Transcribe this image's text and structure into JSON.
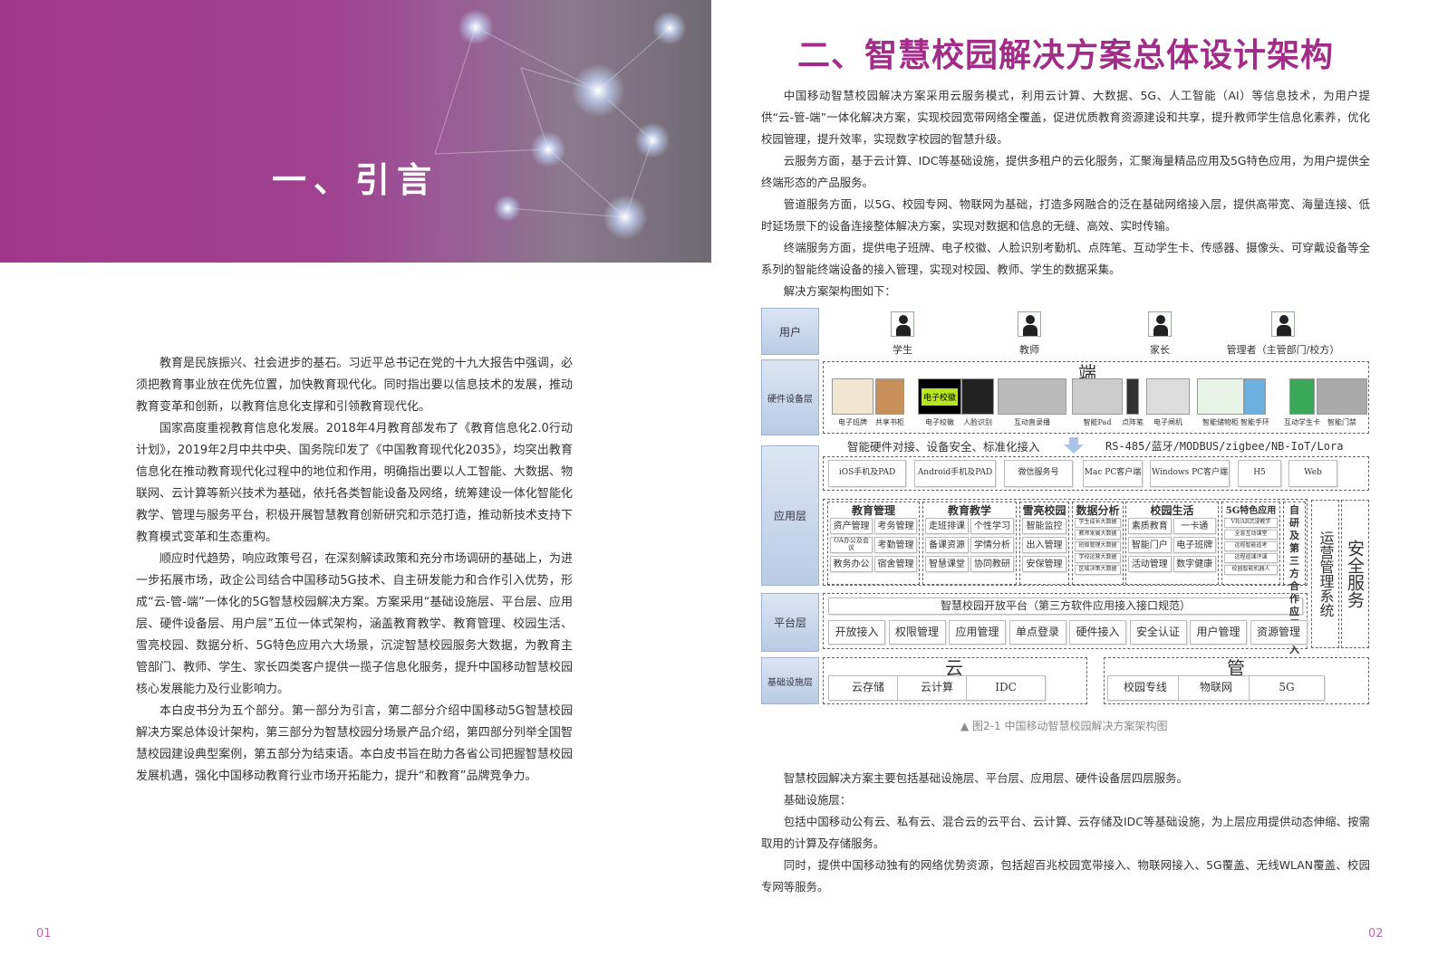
{
  "left_page": {
    "banner_title": "一、引言",
    "paragraphs": [
      "教育是民族振兴、社会进步的基石。习近平总书记在党的十九大报告中强调，必须把教育事业放在优先位置，加快教育现代化。同时指出要以信息技术的发展，推动教育变革和创新，以教育信息化支撑和引领教育现代化。",
      "国家高度重视教育信息化发展。2018年4月教育部发布了《教育信息化2.0行动计划》，2019年2月中共中央、国务院印发了《中国教育现代化2035》，均突出教育信息化在推动教育现代化过程中的地位和作用，明确指出要以人工智能、大数据、物联网、云计算等新兴技术为基础，依托各类智能设备及网络，统筹建设一体化智能化教学、管理与服务平台，积极开展智慧教育创新研究和示范打造，推动新技术支持下教育模式变革和生态重构。",
      "顺应时代趋势，响应政策号召，在深刻解读政策和充分市场调研的基础上，为进一步拓展市场，政企公司结合中国移动5G技术、自主研发能力和合作引入优势，形成“云-管-端”一体化的5G智慧校园解决方案。方案采用“基础设施层、平台层、应用层、硬件设备层、用户层”五位一体式架构，涵盖教育教学、教育管理、校园生活、雪亮校园、数据分析、5G特色应用六大场景，沉淀智慧校园服务大数据，为教育主管部门、教师、学生、家长四类客户提供一揽子信息化服务，提升中国移动智慧校园核心发展能力及行业影响力。",
      "本白皮书分为五个部分。第一部分为引言，第二部分介绍中国移动5G智慧校园解决方案总体设计架构，第三部分为智慧校园分场景产品介绍，第四部分列举全国智慧校园建设典型案例，第五部分为结束语。本白皮书旨在助力各省公司把握智慧校园发展机遇，强化中国移动教育行业市场开拓能力，提升“和教育”品牌竞争力。"
    ],
    "page_number": "01"
  },
  "right_page": {
    "title": "二、智慧校园解决方案总体设计架构",
    "paragraphs": [
      "中国移动智慧校园解决方案采用云服务模式，利用云计算、大数据、5G、人工智能（AI）等信息技术，为用户提供“云-管-端”一体化解决方案，实现校园宽带网络全覆盖，促进优质教育资源建设和共享，提升教师学生信息化素养，优化校园管理，提升效率，实现数字校园的智慧升级。",
      "云服务方面，基于云计算、IDC等基础设施，提供多租户的云化服务，汇聚海量精品应用及5G特色应用，为用户提供全终端形态的产品服务。",
      "管道服务方面，以5G、校园专网、物联网为基础，打造多网融合的泛在基础网络接入层，提供高带宽、海量连接、低时延场景下的设备连接整体解决方案，实现对数据和信息的无缝、高效、实时传输。",
      "终端服务方面，提供电子班牌、电子校徽、人脸识别考勤机、点阵笔、互动学生卡、传感器、摄像头、可穿戴设备等全系列的智能终端设备的接入管理，实现对校园、教师、学生的数据采集。",
      "解决方案架构图如下："
    ],
    "caption": "▲ 图2-1 中国移动智慧校园解决方案架构图",
    "bottom_paragraphs": [
      "智慧校园解决方案主要包括基础设施层、平台层、应用层、硬件设备层四层服务。",
      "基础设施层：",
      "包括中国移动公有云、私有云、混合云的云平台、云计算、云存储及IDC等基础设施，为上层应用提供动态伸缩、按需取用的计算及存储服务。",
      "同时，提供中国移动独有的网络优势资源，包括超百兆校园宽带接入、物联网接入、5G覆盖、无线WLAN覆盖、校园专网等服务。"
    ],
    "page_number": "02"
  },
  "diagram": {
    "layers": {
      "user": "用户",
      "hardware": "硬件设备层",
      "app": "应用层",
      "platform": "平台层",
      "infra": "基础设施层"
    },
    "users": [
      "学生",
      "教师",
      "家长",
      "管理者（主管部门/校方）"
    ],
    "terminal_label": "端",
    "hardware": [
      "电子班牌",
      "共享书柜",
      "电子校徽",
      "人脸识别",
      "互动直录播",
      "智能Pad",
      "点阵笔",
      "电子闸机",
      "智能储物柜",
      "智能手环",
      "互动学生卡",
      "智能门禁"
    ],
    "badge_text": "电子校徽",
    "access_left": "智能硬件对接、设备安全、标准化接入",
    "access_right": "RS-485/蓝牙/MODBUS/zigbee/NB-IoT/Lora",
    "clients": [
      "iOS手机及PAD",
      "Android手机及PAD",
      "微信服务号",
      "Mac PC客户端",
      "Windows PC客户端",
      "H5",
      "Web"
    ],
    "groups": [
      {
        "title": "教育管理",
        "items": [
          "资产管理",
          "考务管理",
          "OA办公及会议",
          "考勤管理",
          "教务办公",
          "宿舍管理"
        ]
      },
      {
        "title": "教育教学",
        "items": [
          "走班排课",
          "个性学习",
          "备课资源",
          "学情分析",
          "智慧课堂",
          "协同教研"
        ]
      },
      {
        "title": "雪亮校园",
        "items": [
          "智能监控",
          "出入管理",
          "安保管理"
        ]
      },
      {
        "title": "数据分析",
        "items": [
          "学生成长大数据",
          "教师发展大数据",
          "班级管理大数据",
          "学校运营大数据",
          "区域决策大数据"
        ]
      },
      {
        "title": "校园生活",
        "items": [
          "素质教育",
          "一卡通",
          "智能门户",
          "电子班牌",
          "活动管理",
          "数字健康"
        ]
      },
      {
        "title": "5G特色应用",
        "items": [
          "VR/AR沉浸教学",
          "全息互动课堂",
          "远程智能巡考",
          "远程巡课评课",
          "校园智能机器人"
        ]
      }
    ],
    "third_party": "自研及第三方合作应用接入",
    "ops": "运营管理系统",
    "security": "安全服务",
    "platform_title": "智慧校园开放平台（第三方软件应用接入接口规范）",
    "platform_items": [
      "开放接入",
      "权限管理",
      "应用管理",
      "单点登录",
      "硬件接入",
      "安全认证",
      "用户管理",
      "资源管理"
    ],
    "cloud_label": "云",
    "cloud_items": [
      "云存储",
      "云计算",
      "IDC"
    ],
    "pipe_label": "管",
    "pipe_items": [
      "校园专线",
      "物联网",
      "5G"
    ]
  },
  "colors": {
    "brand_purple": "#a12d88",
    "layer_blue": "#c5d4ea"
  }
}
